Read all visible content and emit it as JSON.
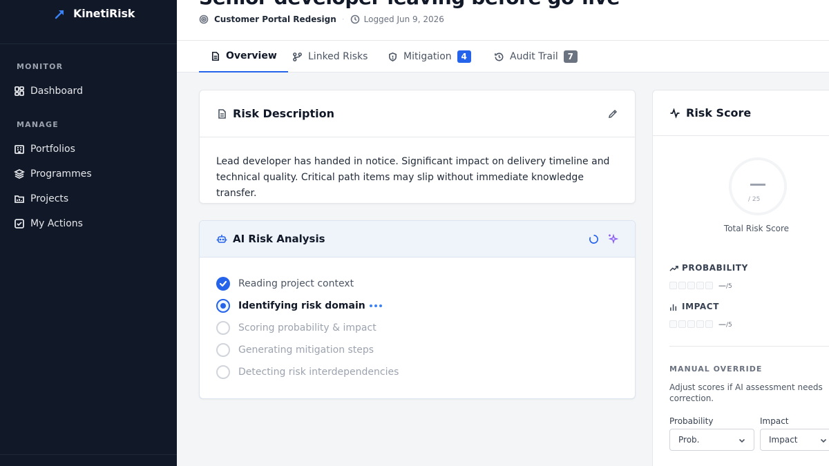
{
  "app": {
    "name": "KinetiRisk",
    "brand_color": "#2563eb"
  },
  "sidebar": {
    "sections": [
      {
        "label": "MONITOR",
        "items": [
          {
            "label": "Dashboard",
            "icon": "dashboard-icon"
          }
        ]
      },
      {
        "label": "MANAGE",
        "items": [
          {
            "label": "Portfolios",
            "icon": "building-icon"
          },
          {
            "label": "Programmes",
            "icon": "layers-icon"
          },
          {
            "label": "Projects",
            "icon": "folder-icon"
          },
          {
            "label": "My Actions",
            "icon": "checkbox-icon"
          }
        ]
      }
    ]
  },
  "header": {
    "title": "Senior developer leaving before go-live",
    "project": "Customer Portal Redesign",
    "logged": "Logged Jun 9, 2026"
  },
  "tabs": [
    {
      "label": "Overview",
      "icon": "document-icon",
      "active": true
    },
    {
      "label": "Linked Risks",
      "icon": "branch-icon"
    },
    {
      "label": "Mitigation",
      "icon": "shield-icon",
      "badge": "4",
      "badge_color": "#2563eb"
    },
    {
      "label": "Audit Trail",
      "icon": "history-icon",
      "badge": "7",
      "badge_color": "#6b7280"
    }
  ],
  "description": {
    "title": "Risk Description",
    "text": "Lead developer has handed in notice. Significant impact on delivery timeline and technical quality. Critical path items may slip without immediate knowledge transfer."
  },
  "ai_analysis": {
    "title": "AI Risk Analysis",
    "steps": [
      {
        "label": "Reading project context",
        "status": "done"
      },
      {
        "label": "Identifying risk domain",
        "status": "active"
      },
      {
        "label": "Scoring probability & impact",
        "status": "pending"
      },
      {
        "label": "Generating mitigation steps",
        "status": "pending"
      },
      {
        "label": "Detecting risk interdependencies",
        "status": "pending"
      }
    ]
  },
  "score": {
    "title": "Risk Score",
    "total_out_of": "/ 25",
    "total_caption": "Total Risk Score",
    "probability": {
      "label": "PROBABILITY",
      "value": "—",
      "out_of": "/5"
    },
    "impact": {
      "label": "IMPACT",
      "value": "—",
      "out_of": "/5"
    },
    "override": {
      "label": "MANUAL OVERRIDE",
      "help": "Adjust scores if AI assessment needs correction.",
      "probability_label": "Probability",
      "probability_value": "Prob.",
      "impact_label": "Impact",
      "impact_value": "Impact"
    }
  }
}
